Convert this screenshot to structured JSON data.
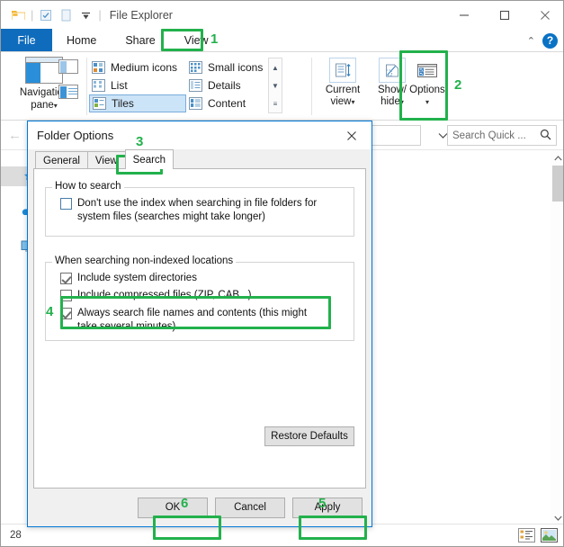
{
  "accent": {
    "green": "#22b14c",
    "ribbon_blue": "#0f6cbd",
    "dialog_border": "#0078d7"
  },
  "window": {
    "title": "File Explorer",
    "quick_access": [
      {
        "name": "folder-icon",
        "glyph": "🗀"
      },
      {
        "name": "properties-icon",
        "glyph": "☑"
      },
      {
        "name": "new-folder-icon",
        "glyph": "▢"
      },
      {
        "name": "customize-qat-icon",
        "glyph": "▾"
      }
    ],
    "controls": {
      "minimize": "—",
      "maximize": "☐",
      "close": "✕"
    }
  },
  "ribbon": {
    "tabs": [
      {
        "label": "File",
        "selected": false
      },
      {
        "label": "Home",
        "selected": false
      },
      {
        "label": "Share",
        "selected": false
      },
      {
        "label": "View",
        "selected": true
      }
    ],
    "collapse_icon": "⌃",
    "help_icon": "?",
    "panes_group": {
      "navigation_pane_label": "Navigation",
      "navigation_pane_label2": "pane",
      "caret": "▾"
    },
    "layout_group": {
      "items": [
        {
          "label": "Medium icons",
          "selected": false
        },
        {
          "label": "Small icons",
          "selected": false
        },
        {
          "label": "List",
          "selected": false
        },
        {
          "label": "Details",
          "selected": false
        },
        {
          "label": "Tiles",
          "selected": true
        },
        {
          "label": "Content",
          "selected": false
        }
      ],
      "scroll_up": "▲",
      "scroll_down": "▼",
      "scroll_more": "≡"
    },
    "commands": [
      {
        "label_line1": "Current",
        "label_line2": "view",
        "caret": "▾",
        "name": "current-view-button"
      },
      {
        "label_line1": "Show/",
        "label_line2": "hide",
        "caret": "▾",
        "name": "show-hide-button"
      },
      {
        "label_line1": "Options",
        "label_line2": "",
        "caret": "▾",
        "name": "options-button"
      }
    ]
  },
  "address_bar": {
    "back_icon": "←",
    "dropdown_icon": "∨",
    "refresh_icon": "↻",
    "search_placeholder": "Search Quick ...",
    "search_icon": "🔍"
  },
  "status_bar": {
    "item_count": "28",
    "views": [
      {
        "name": "details-view-icon"
      },
      {
        "name": "large-icons-view-icon"
      }
    ]
  },
  "dialog": {
    "title": "Folder Options",
    "close_icon": "✕",
    "tabs": [
      {
        "label": "General",
        "selected": false
      },
      {
        "label": "View",
        "selected": false
      },
      {
        "label": "Search",
        "selected": true
      }
    ],
    "group_how_to_search": {
      "title": "How to search",
      "checkbox": {
        "label": "Don't use the index when searching in file folders for system files (searches might take longer)",
        "checked": false
      }
    },
    "group_non_indexed": {
      "title": "When searching non-indexed locations",
      "checkboxes": [
        {
          "label": "Include system directories",
          "checked": true
        },
        {
          "label": "Include compressed files (ZIP, CAB...)",
          "checked": false
        },
        {
          "label": "Always search file names and contents (this might take several minutes)",
          "checked": true
        }
      ]
    },
    "restore_defaults_label": "Restore Defaults",
    "footer_buttons": [
      {
        "label": "OK",
        "name": "ok-button"
      },
      {
        "label": "Cancel",
        "name": "cancel-button"
      },
      {
        "label": "Apply",
        "name": "apply-button"
      }
    ]
  },
  "annotations": {
    "steps": [
      {
        "number": "1",
        "target": "view-tab"
      },
      {
        "number": "2",
        "target": "options-button"
      },
      {
        "number": "3",
        "target": "search-tab"
      },
      {
        "number": "4",
        "target": "always-search-checkbox"
      },
      {
        "number": "5",
        "target": "apply-button"
      },
      {
        "number": "6",
        "target": "ok-button"
      }
    ]
  }
}
